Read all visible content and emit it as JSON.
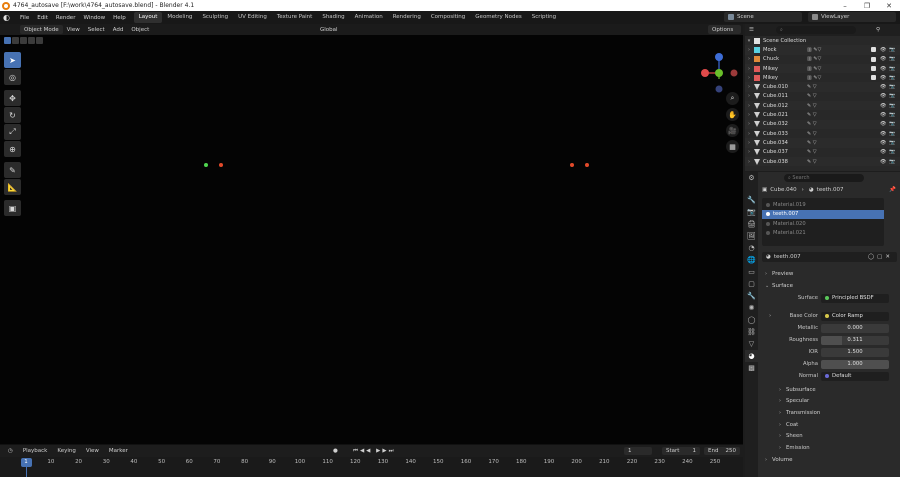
{
  "window": {
    "title": "4764_autosave [F:\\work\\4764_autosave.blend] - Blender 4.1",
    "minimize": "–",
    "maximize": "❐",
    "close": "✕"
  },
  "menu": {
    "items": [
      "File",
      "Edit",
      "Render",
      "Window",
      "Help"
    ],
    "workspaces": [
      "Layout",
      "Modeling",
      "Sculpting",
      "UV Editing",
      "Texture Paint",
      "Shading",
      "Animation",
      "Rendering",
      "Compositing",
      "Geometry Nodes",
      "Scripting"
    ],
    "active_workspace": "Layout",
    "scene": "Scene",
    "view_layer": "ViewLayer"
  },
  "viewport": {
    "mode": "Object Mode",
    "menus": [
      "View",
      "Select",
      "Add",
      "Object"
    ],
    "orientation": "Global",
    "options": "Options",
    "gizmo_colors": {
      "x": "#e04a4a",
      "y": "#6abf2a",
      "z": "#3d6dd6"
    },
    "eye_colors": {
      "green": "#4fd64f",
      "red": "#e24a2a"
    }
  },
  "outliner": {
    "search_placeholder": "",
    "root": "Scene Collection",
    "rows": [
      {
        "name": "Mock",
        "color": "#5ad1e0",
        "type": "collection"
      },
      {
        "name": "Chuck",
        "color": "#e08a3a",
        "type": "collection"
      },
      {
        "name": "Mikey",
        "color": "#e05a5a",
        "type": "collection"
      },
      {
        "name": "Mikey",
        "color": "#e05a5a",
        "type": "collection"
      },
      {
        "name": "Cube.010",
        "type": "mesh"
      },
      {
        "name": "Cube.011",
        "type": "mesh"
      },
      {
        "name": "Cube.012",
        "type": "mesh"
      },
      {
        "name": "Cube.021",
        "type": "mesh"
      },
      {
        "name": "Cube.032",
        "type": "mesh"
      },
      {
        "name": "Cube.033",
        "type": "mesh"
      },
      {
        "name": "Cube.034",
        "type": "mesh"
      },
      {
        "name": "Cube.037",
        "type": "mesh"
      },
      {
        "name": "Cube.038",
        "type": "mesh"
      }
    ]
  },
  "properties": {
    "search_placeholder": "Search",
    "object": "Cube.040",
    "material": "teeth.007",
    "slots": [
      "Material.019",
      "teeth.007",
      "Material.020",
      "Material.021"
    ],
    "selected_slot": 1,
    "material_name": "teeth.007",
    "panels": {
      "preview": "Preview",
      "surface": "Surface",
      "volume": "Volume"
    },
    "surface": {
      "surface_label": "Surface",
      "surface_value": "Principled BSDF",
      "base_color_label": "Base Color",
      "base_color_value": "Color Ramp",
      "metallic_label": "Metallic",
      "metallic_value": "0.000",
      "roughness_label": "Roughness",
      "roughness_value": "0.311",
      "ior_label": "IOR",
      "ior_value": "1.500",
      "alpha_label": "Alpha",
      "alpha_value": "1.000",
      "normal_label": "Normal",
      "normal_value": "Default"
    },
    "subpanels": [
      "Subsurface",
      "Specular",
      "Transmission",
      "Coat",
      "Sheen",
      "Emission"
    ]
  },
  "timeline": {
    "menus": [
      "Playback",
      "Keying",
      "View",
      "Marker"
    ],
    "current_frame": "1",
    "start_label": "Start",
    "start": "1",
    "end_label": "End",
    "end": "250",
    "ticks": [
      "10",
      "20",
      "30",
      "40",
      "50",
      "60",
      "70",
      "80",
      "90",
      "100",
      "110",
      "120",
      "130",
      "140",
      "150",
      "160",
      "170",
      "180",
      "190",
      "200",
      "210",
      "220",
      "230",
      "240",
      "250"
    ],
    "playhead_label": "1"
  }
}
